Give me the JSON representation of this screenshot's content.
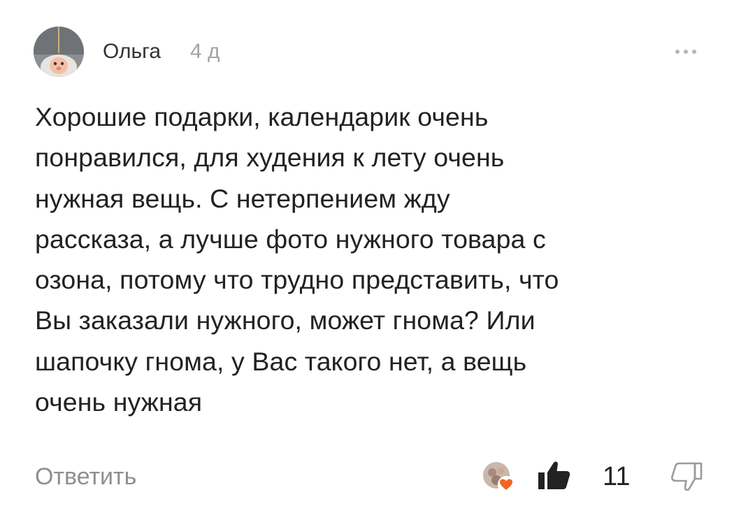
{
  "comment": {
    "author": "Ольга",
    "time": "4 д",
    "text": "Хорошие подарки, календарик очень\nпонравился, для худения к лету очень\nнужная вещь. С нетерпением жду\nрассказа, а лучше фото нужного товара с\nозона, потому что трудно представить, что\nВы заказали нужного, может гнома? Или\nшапочку гнома, у Вас такого нет, а вещь\nочень нужная",
    "reply_label": "Ответить",
    "likes": "11"
  },
  "icons": {
    "more": "more-horizontal-icon",
    "like": "thumbs-up-filled-icon",
    "dislike": "thumbs-down-outline-icon",
    "reaction": "heart-icon"
  },
  "colors": {
    "text": "#222222",
    "muted": "#8f8f8f",
    "time": "#a3a3a3",
    "reaction": "#f26522"
  }
}
